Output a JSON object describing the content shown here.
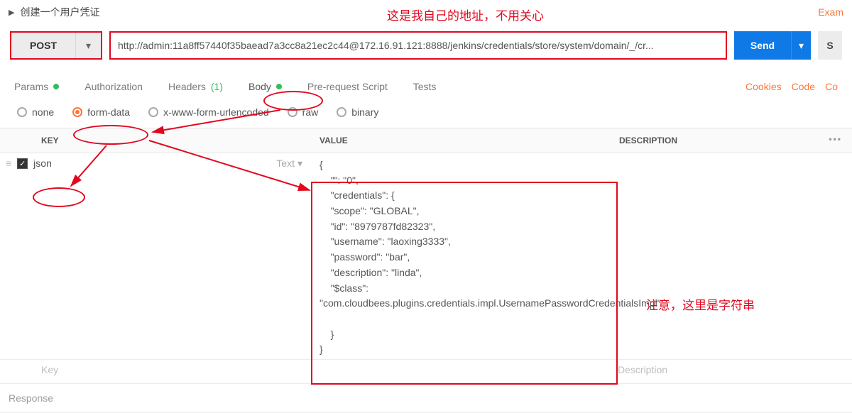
{
  "title": "创建一个用户凭证",
  "exam_link": "Exam",
  "annotations": {
    "top": "这是我自己的地址，不用关心",
    "right": "注意，这里是字符串"
  },
  "request": {
    "method": "POST",
    "url": "http://admin:11a8ff57440f35baead7a3cc8a21ec2c44@172.16.91.121:8888/jenkins/credentials/store/system/domain/_/cr...",
    "send": "Send",
    "save_initial": "S"
  },
  "tabs": {
    "params": "Params",
    "auth": "Authorization",
    "headers": "Headers",
    "headers_count": "(1)",
    "body": "Body",
    "prerequest": "Pre-request Script",
    "tests": "Tests",
    "cookies": "Cookies",
    "code": "Code",
    "co": "Co"
  },
  "body_types": {
    "none": "none",
    "formdata": "form-data",
    "xwww": "x-www-form-urlencoded",
    "raw": "raw",
    "binary": "binary"
  },
  "table": {
    "key_h": "KEY",
    "val_h": "VALUE",
    "desc_h": "DESCRIPTION",
    "row1_key": "json",
    "row1_type": "Text",
    "row1_value": "{\n    \"\": \"0\",\n    \"credentials\": {\n    \"scope\": \"GLOBAL\",\n    \"id\": \"8979787fd82323\",\n    \"username\": \"laoxing3333\",\n    \"password\": \"bar\",\n    \"description\": \"linda\",\n    \"$class\":\n\"com.cloudbees.plugins.credentials.impl.UsernamePasswordCredentialsImpl\"\n\n    }\n}",
    "row2_key_ph": "Key",
    "row2_desc_ph": "Description"
  },
  "response_label": "Response"
}
